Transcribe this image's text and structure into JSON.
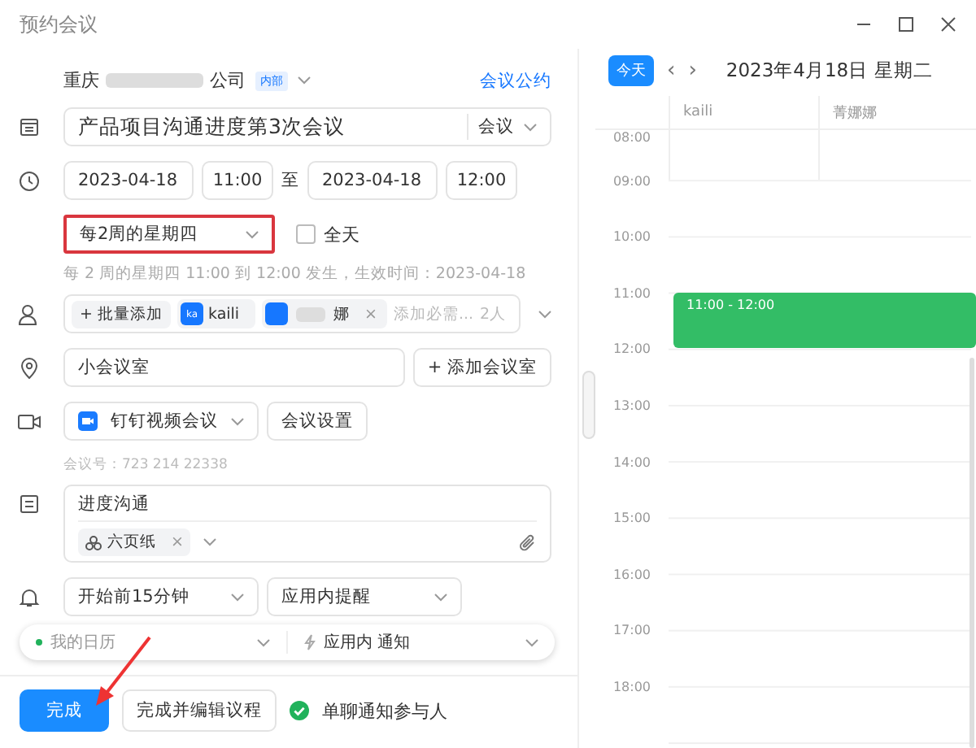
{
  "window": {
    "title": "预约会议"
  },
  "org": {
    "name_start": "重庆",
    "name_end": "公司",
    "badge": "内部",
    "link": "会议公约"
  },
  "title_field": {
    "value": "产品项目沟通进度第3次会议",
    "type": "会议"
  },
  "time": {
    "start_date": "2023-04-18",
    "start_time": "11:00",
    "separator": "至",
    "end_date": "2023-04-18",
    "end_time": "12:00"
  },
  "recurrence": {
    "value": "每2周的星期四",
    "highlighted": true,
    "all_day_label": "全天",
    "all_day": false,
    "summary": "每 2 周的星期四 11:00 到 12:00 发生，生效时间：2023-04-18"
  },
  "attendees": {
    "batch_add": "+ 批量添加",
    "people": [
      {
        "avatar": "ka",
        "name": "kaili",
        "removable": false
      },
      {
        "name": "娜",
        "removable": true,
        "remove": "×"
      }
    ],
    "placeholder": "添加必需...",
    "count": "2人"
  },
  "location": {
    "value": "小会议室",
    "add_room": "+ 添加会议室"
  },
  "video": {
    "value": "钉钉视频会议",
    "settings": "会议设置",
    "meeting_number": "会议号：723 214 22338"
  },
  "notes": {
    "value": "进度沟通",
    "attachment": "六页纸",
    "remove": "×"
  },
  "reminder": {
    "when": "开始前15分钟",
    "how": "应用内提醒"
  },
  "calendar_select": {
    "value": "我的日历",
    "notify": "应用内 通知"
  },
  "footer": {
    "done": "完成",
    "done_edit": "完成并编辑议程",
    "notify_label": "单聊通知参与人",
    "notify": true
  },
  "annotation_arrow": true,
  "schedule": {
    "today": "今天",
    "prev": "‹",
    "next": "›",
    "date": "2023年4月18日 星期二",
    "columns": [
      "kaili",
      "菁娜娜"
    ],
    "hours": [
      "08:00",
      "09:00",
      "10:00",
      "11:00",
      "12:00",
      "13:00",
      "14:00",
      "15:00",
      "16:00",
      "17:00",
      "18:00"
    ],
    "event": {
      "label": "11:00 - 12:00"
    }
  }
}
